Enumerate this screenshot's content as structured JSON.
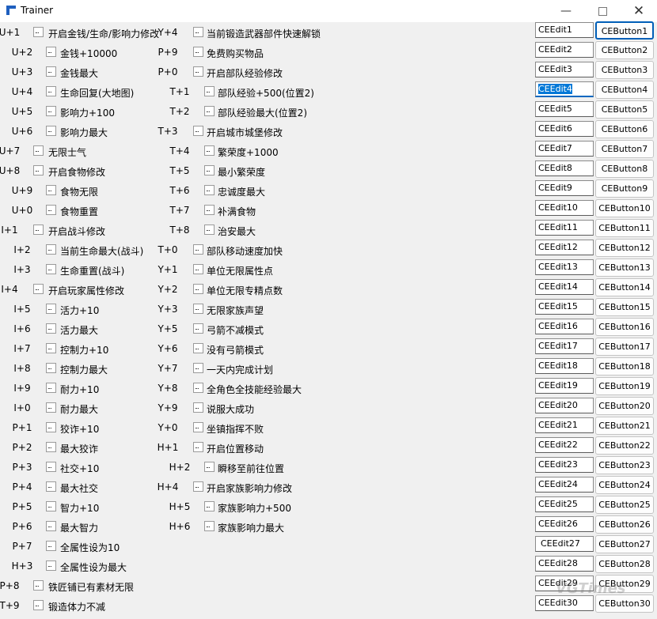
{
  "window": {
    "title": "Trainer"
  },
  "column1": [
    {
      "hotkey": "U+1",
      "label": "开启金钱/生命/影响力修改"
    },
    {
      "hotkey": "U+2",
      "label": "金钱+10000"
    },
    {
      "hotkey": "U+3",
      "label": "金钱最大"
    },
    {
      "hotkey": "U+4",
      "label": "生命回复(大地图)"
    },
    {
      "hotkey": "U+5",
      "label": "影响力+100"
    },
    {
      "hotkey": "U+6",
      "label": "影响力最大"
    },
    {
      "hotkey": "U+7",
      "label": "无限士气"
    },
    {
      "hotkey": "U+8",
      "label": "开启食物修改"
    },
    {
      "hotkey": "U+9",
      "label": "食物无限"
    },
    {
      "hotkey": "U+0",
      "label": "食物重置"
    },
    {
      "hotkey": "I+1",
      "label": "开启战斗修改"
    },
    {
      "hotkey": "I+2",
      "label": "当前生命最大(战斗)"
    },
    {
      "hotkey": "I+3",
      "label": "生命重置(战斗)"
    },
    {
      "hotkey": "I+4",
      "label": "开启玩家属性修改"
    },
    {
      "hotkey": "I+5",
      "label": "活力+10"
    },
    {
      "hotkey": "I+6",
      "label": "活力最大"
    },
    {
      "hotkey": "I+7",
      "label": "控制力+10"
    },
    {
      "hotkey": "I+8",
      "label": "控制力最大"
    },
    {
      "hotkey": "I+9",
      "label": "耐力+10"
    },
    {
      "hotkey": "I+0",
      "label": "耐力最大"
    },
    {
      "hotkey": "P+1",
      "label": "狡诈+10"
    },
    {
      "hotkey": "P+2",
      "label": "最大狡诈"
    },
    {
      "hotkey": "P+3",
      "label": "社交+10"
    },
    {
      "hotkey": "P+4",
      "label": "最大社交"
    },
    {
      "hotkey": "P+5",
      "label": "智力+10"
    },
    {
      "hotkey": "P+6",
      "label": "最大智力"
    },
    {
      "hotkey": "P+7",
      "label": "全属性设为10"
    },
    {
      "hotkey": "H+3",
      "label": "全属性设为最大"
    },
    {
      "hotkey": "P+8",
      "label": "铁匠铺已有素材无限"
    },
    {
      "hotkey": "T+9",
      "label": "锻造体力不减"
    }
  ],
  "column2": [
    {
      "hotkey": "Y+4",
      "label": "当前锻造武器部件快速解锁"
    },
    {
      "hotkey": "P+9",
      "label": "免费购买物品"
    },
    {
      "hotkey": "P+0",
      "label": "开启部队经验修改"
    },
    {
      "hotkey": "T+1",
      "label": "部队经验+500(位置2)"
    },
    {
      "hotkey": "T+2",
      "label": "部队经验最大(位置2)"
    },
    {
      "hotkey": "T+3",
      "label": "开启城市城堡修改"
    },
    {
      "hotkey": "T+4",
      "label": "繁荣度+1000"
    },
    {
      "hotkey": "T+5",
      "label": "最小繁荣度"
    },
    {
      "hotkey": "T+6",
      "label": "忠诚度最大"
    },
    {
      "hotkey": "T+7",
      "label": "补满食物"
    },
    {
      "hotkey": "T+8",
      "label": "治安最大"
    },
    {
      "hotkey": "T+0",
      "label": "部队移动速度加快"
    },
    {
      "hotkey": "Y+1",
      "label": "单位无限属性点"
    },
    {
      "hotkey": "Y+2",
      "label": "单位无限专精点数"
    },
    {
      "hotkey": "Y+3",
      "label": "无限家族声望"
    },
    {
      "hotkey": "Y+5",
      "label": "弓箭不减模式"
    },
    {
      "hotkey": "Y+6",
      "label": "没有弓箭模式"
    },
    {
      "hotkey": "Y+7",
      "label": "一天内完成计划"
    },
    {
      "hotkey": "Y+8",
      "label": "全角色全技能经验最大"
    },
    {
      "hotkey": "Y+9",
      "label": "说服大成功"
    },
    {
      "hotkey": "Y+0",
      "label": "坐镇指挥不败"
    },
    {
      "hotkey": "H+1",
      "label": "开启位置移动"
    },
    {
      "hotkey": "H+2",
      "label": "瞬移至前往位置"
    },
    {
      "hotkey": "H+4",
      "label": "开启家族影响力修改"
    },
    {
      "hotkey": "H+5",
      "label": "家族影响力+500"
    },
    {
      "hotkey": "H+6",
      "label": "家族影响力最大"
    }
  ],
  "edits": [
    "CEEdit1",
    "CEEdit2",
    "CEEdit3",
    "CEEdit4",
    "CEEdit5",
    "CEEdit6",
    "CEEdit7",
    "CEEdit8",
    "CEEdit9",
    "CEEdit10",
    "CEEdit11",
    "CEEdit12",
    "CEEdit13",
    "CEEdit14",
    "CEEdit15",
    "CEEdit16",
    "CEEdit17",
    "CEEdit18",
    "CEEdit19",
    "CEEdit20",
    "CEEdit21",
    "CEEdit22",
    "CEEdit23",
    "CEEdit24",
    "CEEdit25",
    "CEEdit26",
    "CEEdit27",
    "CEEdit28",
    "CEEdit29",
    "CEEdit30"
  ],
  "buttons": [
    "CEButton1",
    "CEButton2",
    "CEButton3",
    "CEButton4",
    "CEButton5",
    "CEButton6",
    "CEButton7",
    "CEButton8",
    "CEButton9",
    "CEButton10",
    "CEButton11",
    "CEButton12",
    "CEButton13",
    "CEButton14",
    "CEButton15",
    "CEButton16",
    "CEButton17",
    "CEButton18",
    "CEButton19",
    "CEButton20",
    "CEButton21",
    "CEButton22",
    "CEButton23",
    "CEButton24",
    "CEButton25",
    "CEButton26",
    "CEButton27",
    "CEButton28",
    "CEButton29",
    "CEButton30"
  ],
  "watermark": "VGTimes"
}
